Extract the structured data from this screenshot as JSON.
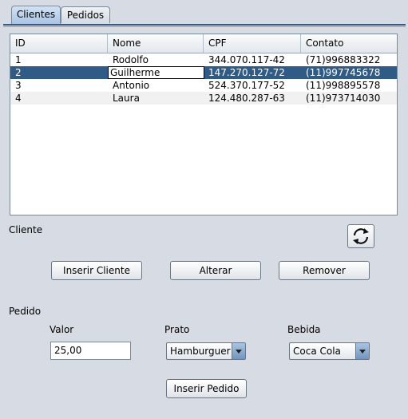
{
  "tabs": [
    {
      "label": "Clientes",
      "active": true
    },
    {
      "label": "Pedidos",
      "active": false
    }
  ],
  "table": {
    "columns": [
      "ID",
      "Nome",
      "CPF",
      "Contato"
    ],
    "rows": [
      {
        "id": "1",
        "nome": "Rodolfo",
        "cpf": "344.070.117-42",
        "contato": "(71)996883322"
      },
      {
        "id": "2",
        "nome": "Guilherme",
        "cpf": "147.270.127-72",
        "contato": "(11)997745678",
        "selected": true
      },
      {
        "id": "3",
        "nome": "Antonio",
        "cpf": "524.370.177-52",
        "contato": "(11)998895578"
      },
      {
        "id": "4",
        "nome": "Laura",
        "cpf": "124.480.287-63",
        "contato": "(11)973714030"
      }
    ]
  },
  "cliente": {
    "section_label": "Cliente",
    "refresh_icon": "refresh-icon",
    "buttons": {
      "inserir": "Inserir Cliente",
      "alterar": "Alterar",
      "remover": "Remover"
    }
  },
  "pedido": {
    "section_label": "Pedido",
    "valor_label": "Valor",
    "valor_value": "25,00",
    "prato_label": "Prato",
    "prato_selected": "Hamburguer",
    "bebida_label": "Bebida",
    "bebida_selected": "Coca Cola",
    "inserir_button": "Inserir Pedido"
  },
  "colors": {
    "selection": "#305b87",
    "tab_active": "#a9c4e2",
    "background": "#d7dbe3"
  }
}
